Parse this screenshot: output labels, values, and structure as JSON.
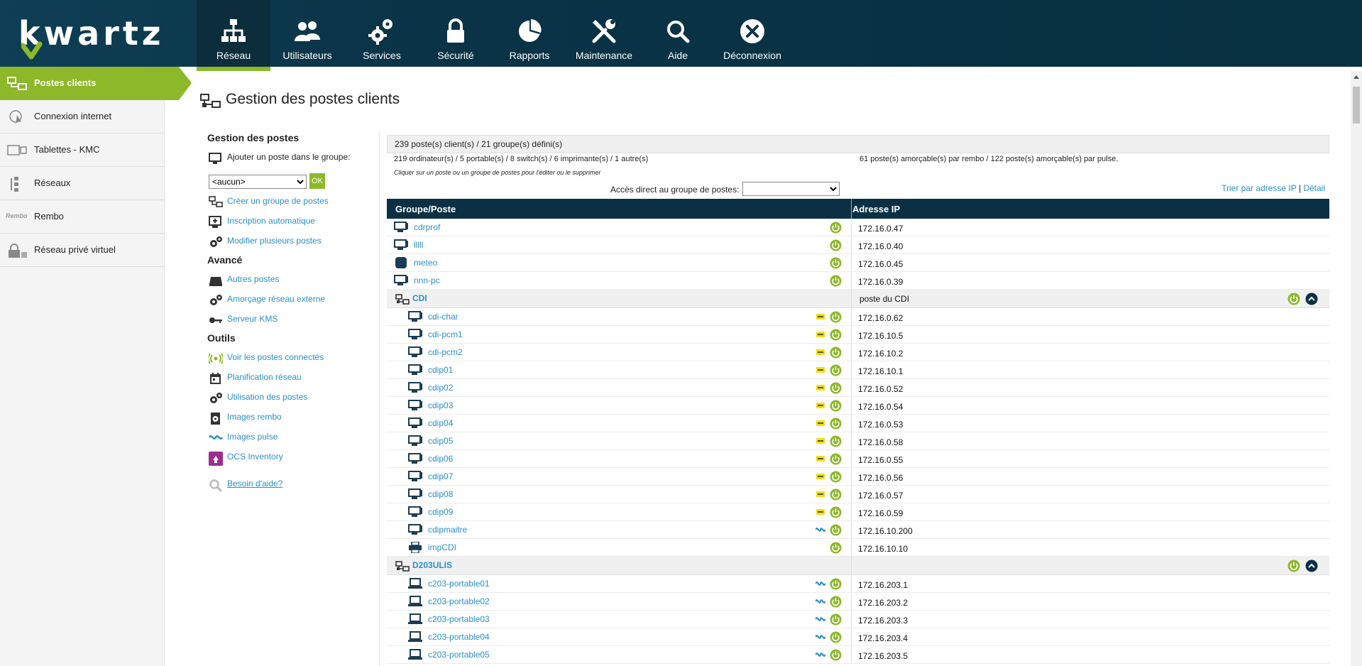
{
  "brand": {
    "logo_text": "kwartz"
  },
  "colors": {
    "accent": "#8cb82a",
    "nav_bg": "#0a3347",
    "link": "#2a90c8"
  },
  "nav": [
    {
      "label": "Réseau",
      "icon": "network-icon",
      "active": true
    },
    {
      "label": "Utilisateurs",
      "icon": "users-icon"
    },
    {
      "label": "Services",
      "icon": "gears-icon"
    },
    {
      "label": "Sécurité",
      "icon": "lock-icon"
    },
    {
      "label": "Rapports",
      "icon": "pie-chart-icon"
    },
    {
      "label": "Maintenance",
      "icon": "tools-icon"
    },
    {
      "label": "Aide",
      "icon": "search-icon"
    },
    {
      "label": "Déconnexion",
      "icon": "close-circle-icon"
    }
  ],
  "sidebar": [
    {
      "label": "Postes clients",
      "icon": "client-stations-icon",
      "active": true
    },
    {
      "label": "Connexion internet",
      "icon": "internet-icon"
    },
    {
      "label": "Tablettes - KMC",
      "icon": "tablet-icon"
    },
    {
      "label": "Réseaux",
      "icon": "networks-icon"
    },
    {
      "label": "Rembo",
      "icon": "rembo-logo",
      "icon_text": "Rembo"
    },
    {
      "label": "Réseau privé virtuel",
      "icon": "vpn-icon"
    }
  ],
  "page": {
    "title": "Gestion des postes clients"
  },
  "menu": {
    "gestion_heading": "Gestion des postes",
    "add_label": "Ajouter un poste dans le groupe:",
    "group_select": "<aucun>",
    "ok_label": "OK",
    "gestion_links": [
      "Créer un groupe de postes",
      "Inscription automatique",
      "Modifier plusieurs postes"
    ],
    "avance_heading": "Avancé",
    "avance_links": [
      "Autres postes",
      "Amorçage réseau externe",
      "Serveur KMS"
    ],
    "outils_heading": "Outils",
    "outils_links": [
      "Voir les postes connectés",
      "Planification réseau",
      "Utilisation des postes",
      "Images rembo",
      "Images pulse",
      "OCS Inventory"
    ],
    "help_label": "Besoin d'aide?"
  },
  "panel": {
    "summary": "239 poste(s) client(s) / 21 groupe(s) défini(s)",
    "stats_left": "219 ordinateur(s) / 5 portable(s) / 8 switch(s) / 6 imprimante(s) / 1 autre(s)",
    "stats_right": "61 poste(s) amorçable(s) par rembo / 122 poste(s) amorçable(s) par pulse.",
    "hint": "Cliquer sur un poste ou un groupe de postes pour l'éditer ou le supprimer",
    "direct_access_label": "Accès direct au groupe de postes:",
    "sort_ip": "Trier par adresse IP",
    "sort_sep": "|",
    "sort_detail": "Détail"
  },
  "table": {
    "headers": [
      "Groupe/Poste",
      "Adresse IP"
    ],
    "rows": [
      {
        "kind": "host",
        "indent": 0,
        "type": "computer",
        "name": "cdrprof",
        "ip": "172.16.0.47"
      },
      {
        "kind": "host",
        "indent": 0,
        "type": "computer",
        "name": "lllll",
        "ip": "172.16.0.40"
      },
      {
        "kind": "host",
        "indent": 0,
        "type": "other",
        "name": "meteo",
        "ip": "172.16.0.45"
      },
      {
        "kind": "host",
        "indent": 0,
        "type": "computer",
        "name": "nnn-pc",
        "ip": "172.16.0.39"
      },
      {
        "kind": "group",
        "name": "CDI",
        "ip": "poste du CDI"
      },
      {
        "kind": "host",
        "indent": 1,
        "type": "computer",
        "badge": "rembo",
        "name": "cdi-char",
        "ip": "172.16.0.62"
      },
      {
        "kind": "host",
        "indent": 1,
        "type": "computer",
        "badge": "rembo",
        "name": "cdi-pcm1",
        "ip": "172.16.10.5"
      },
      {
        "kind": "host",
        "indent": 1,
        "type": "computer",
        "badge": "rembo",
        "name": "cdi-pcm2",
        "ip": "172.16.10.2"
      },
      {
        "kind": "host",
        "indent": 1,
        "type": "computer",
        "badge": "rembo",
        "name": "cdip01",
        "ip": "172.16.10.1"
      },
      {
        "kind": "host",
        "indent": 1,
        "type": "computer",
        "badge": "rembo",
        "name": "cdip02",
        "ip": "172.16.0.52"
      },
      {
        "kind": "host",
        "indent": 1,
        "type": "computer",
        "badge": "rembo",
        "name": "cdip03",
        "ip": "172.16.0.54"
      },
      {
        "kind": "host",
        "indent": 1,
        "type": "computer",
        "badge": "rembo",
        "name": "cdip04",
        "ip": "172.16.0.53"
      },
      {
        "kind": "host",
        "indent": 1,
        "type": "computer",
        "badge": "rembo",
        "name": "cdip05",
        "ip": "172.16.0.58"
      },
      {
        "kind": "host",
        "indent": 1,
        "type": "computer",
        "badge": "rembo",
        "name": "cdip06",
        "ip": "172.16.0.55"
      },
      {
        "kind": "host",
        "indent": 1,
        "type": "computer",
        "badge": "rembo",
        "name": "cdip07",
        "ip": "172.16.0.56"
      },
      {
        "kind": "host",
        "indent": 1,
        "type": "computer",
        "badge": "rembo",
        "name": "cdip08",
        "ip": "172.16.0.57"
      },
      {
        "kind": "host",
        "indent": 1,
        "type": "computer",
        "badge": "rembo",
        "name": "cdip09",
        "ip": "172.16.0.59"
      },
      {
        "kind": "host",
        "indent": 1,
        "type": "computer",
        "badge": "pulse",
        "name": "cdipmaitre",
        "ip": "172.16.10.200"
      },
      {
        "kind": "host",
        "indent": 1,
        "type": "printer",
        "name": "impCDI",
        "ip": "172.16.10.10"
      },
      {
        "kind": "group",
        "name": "D203ULIS",
        "ip": ""
      },
      {
        "kind": "host",
        "indent": 1,
        "type": "laptop",
        "badge": "pulse",
        "name": "c203-portable01",
        "ip": "172.16.203.1"
      },
      {
        "kind": "host",
        "indent": 1,
        "type": "laptop",
        "badge": "pulse",
        "name": "c203-portable02",
        "ip": "172.16.203.2"
      },
      {
        "kind": "host",
        "indent": 1,
        "type": "laptop",
        "badge": "pulse",
        "name": "c203-portable03",
        "ip": "172.16.203.3"
      },
      {
        "kind": "host",
        "indent": 1,
        "type": "laptop",
        "badge": "pulse",
        "name": "c203-portable04",
        "ip": "172.16.203.4"
      },
      {
        "kind": "host",
        "indent": 1,
        "type": "laptop",
        "badge": "pulse",
        "name": "c203-portable05",
        "ip": "172.16.203.5"
      }
    ]
  }
}
